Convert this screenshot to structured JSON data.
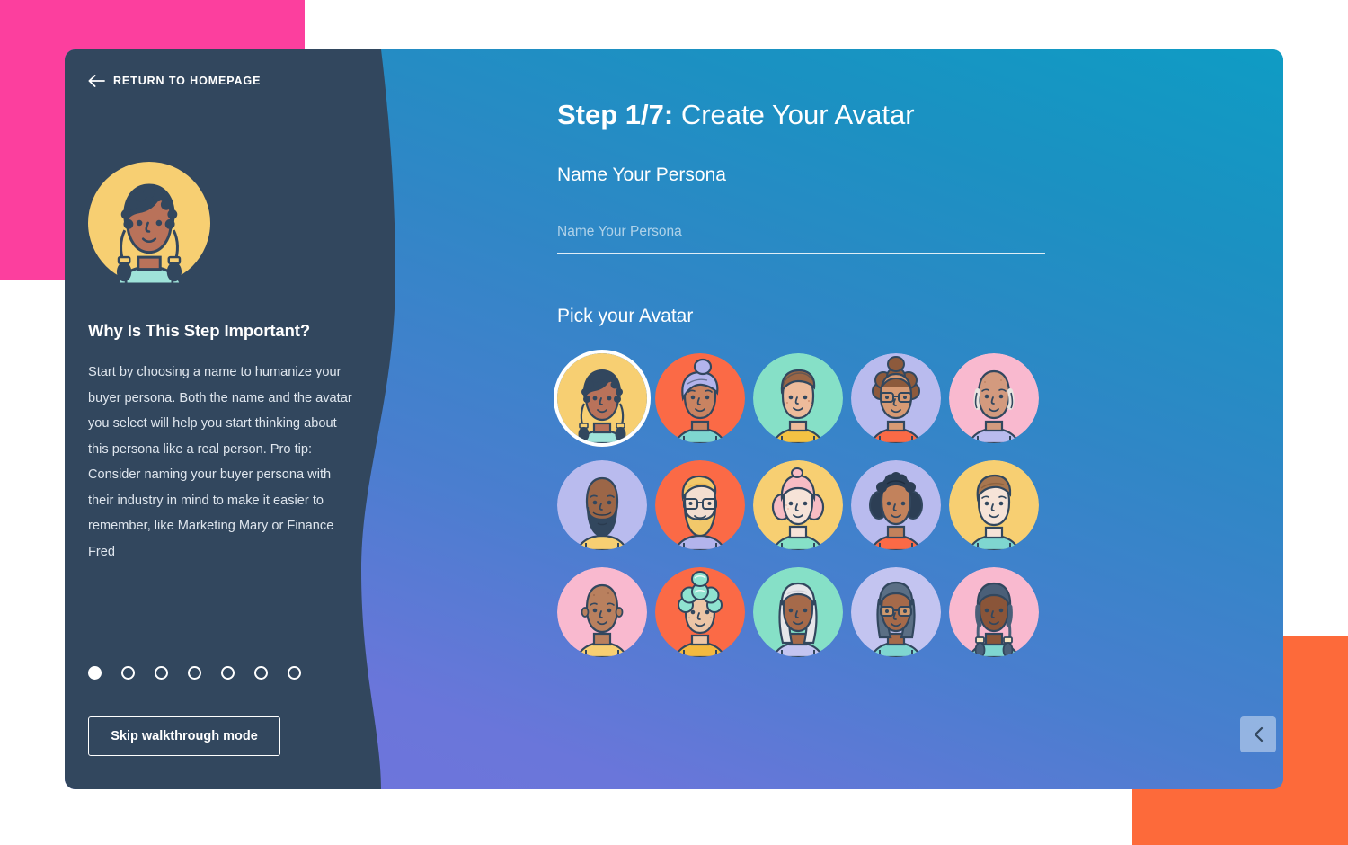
{
  "decor": {
    "pink_block_color": "#fc3f9e",
    "orange_block_color": "#fd6a3a"
  },
  "card": {
    "sidebar_color": "#32475e",
    "panel_gradient_from": "#0f9cc4",
    "panel_gradient_to": "#7173dd"
  },
  "sidebar": {
    "return_link": "RETURN TO HOMEPAGE",
    "back_icon": "arrow-left-icon",
    "persona_avatar_icon": "persona-avatar-braids",
    "heading": "Why Is This Step Important?",
    "body": "Start by choosing a name to humanize your buyer persona. Both the name and the avatar you select will help you start thinking about this persona like a real person. Pro tip: Consider naming your buyer persona with their industry in mind to make it easier to remember, like Marketing Mary or Finance Fred",
    "skip_button": "Skip walkthrough mode",
    "pagination": {
      "total": 7,
      "active_index": 0
    }
  },
  "main": {
    "step_prefix": "Step 1/7:",
    "step_title": "Create Your Avatar",
    "step_current": 1,
    "step_total": 7,
    "name_field": {
      "label": "Name Your Persona",
      "placeholder": "Name Your Persona",
      "value": ""
    },
    "pick_label": "Pick your Avatar",
    "nav": {
      "prev_icon": "chevron-left-icon",
      "prev_enabled": false,
      "next_icon": "chevron-right-icon",
      "next_enabled": true
    },
    "scrollbar": {
      "name": "vertical-scrollbar"
    }
  },
  "avatars": [
    {
      "id": "avatar-1",
      "selected": true,
      "bg": "#f7cf72",
      "skin": "#b9725a",
      "hair": "#32475e",
      "shirt": "#9fe3d9",
      "style": "braids",
      "desc": "woman-braids-yellow"
    },
    {
      "id": "avatar-2",
      "selected": false,
      "bg": "#fb6a46",
      "skin": "#c98361",
      "hair": "#b3b4ec",
      "shirt": "#7fd6d0",
      "style": "bun",
      "desc": "person-lavender-bun-orange"
    },
    {
      "id": "avatar-3",
      "selected": false,
      "bg": "#86e0c7",
      "skin": "#edbb9b",
      "hair": "#9a6646",
      "shirt": "#f4c councils",
      "style": "swoop",
      "desc": "man-brown-swoop-mint"
    },
    {
      "id": "avatar-4",
      "selected": false,
      "bg": "#b9bbee",
      "skin": "#d79a74",
      "hair": "#8d5a3c",
      "shirt": "#fb6a46",
      "style": "afro-bun-glasses",
      "desc": "person-afro-bun-glasses-lavender"
    },
    {
      "id": "avatar-5",
      "selected": false,
      "bg": "#f9b9cf",
      "skin": "#d39a7e",
      "hair": "#e8e4e0",
      "shirt": "#b9bbee",
      "style": "bald-sides",
      "desc": "older-man-bald-pink"
    },
    {
      "id": "avatar-6",
      "selected": false,
      "bg": "#b9bbee",
      "skin": "#9c6647",
      "hair": "#32475e",
      "shirt": "#f7cf72",
      "style": "bald-beard",
      "desc": "man-beard-bald-lavender"
    },
    {
      "id": "avatar-7",
      "selected": false,
      "bg": "#fb6a46",
      "skin": "#f3ded0",
      "hair": "#f2c86a",
      "shirt": "#b3b4ec",
      "style": "beard-glasses",
      "desc": "man-blond-beard-glasses-orange"
    },
    {
      "id": "avatar-8",
      "selected": false,
      "bg": "#f7cf72",
      "skin": "#f6e3d8",
      "hair": "#f7bcc4",
      "shirt": "#86e0c7",
      "style": "bob",
      "desc": "woman-pink-bob-yellow"
    },
    {
      "id": "avatar-9",
      "selected": false,
      "bg": "#b9bbee",
      "skin": "#c2825c",
      "hair": "#2c3e54",
      "shirt": "#fb6a46",
      "style": "curly-bob",
      "desc": "woman-dark-curls-lavender"
    },
    {
      "id": "avatar-10",
      "selected": false,
      "bg": "#f7cf72",
      "skin": "#f6e3d8",
      "hair": "#a8764f",
      "shirt": "#7fd6d0",
      "style": "short",
      "desc": "man-brown-hair-yellow"
    },
    {
      "id": "avatar-11",
      "selected": false,
      "bg": "#f9b9cf",
      "skin": "#b9805e",
      "hair": "#b9805e",
      "shirt": "#f7cf72",
      "style": "bald",
      "desc": "bald-man-pink"
    },
    {
      "id": "avatar-12",
      "selected": false,
      "bg": "#fb6a46",
      "skin": "#edc5a6",
      "hair": "#8fe3d0",
      "shirt": "#f4b93f",
      "style": "curly-tall",
      "desc": "person-mint-curls-orange"
    },
    {
      "id": "avatar-13",
      "selected": false,
      "bg": "#86e0c7",
      "skin": "#a66a4a",
      "hair": "#e6e6ea",
      "shirt": "#c3c4f0",
      "style": "long-white",
      "desc": "woman-white-hair-mint"
    },
    {
      "id": "avatar-14",
      "selected": false,
      "bg": "#c3c4f0",
      "skin": "#a66a4a",
      "hair": "#5b6f85",
      "shirt": "#7fd6d0",
      "style": "straight-glasses",
      "desc": "woman-glasses-lavender"
    },
    {
      "id": "avatar-15",
      "selected": false,
      "bg": "#f9b9cf",
      "skin": "#8a5539",
      "hair": "#4a5f78",
      "shirt": "#7fd6d0",
      "style": "two-braids",
      "desc": "woman-two-braids-pink"
    }
  ]
}
